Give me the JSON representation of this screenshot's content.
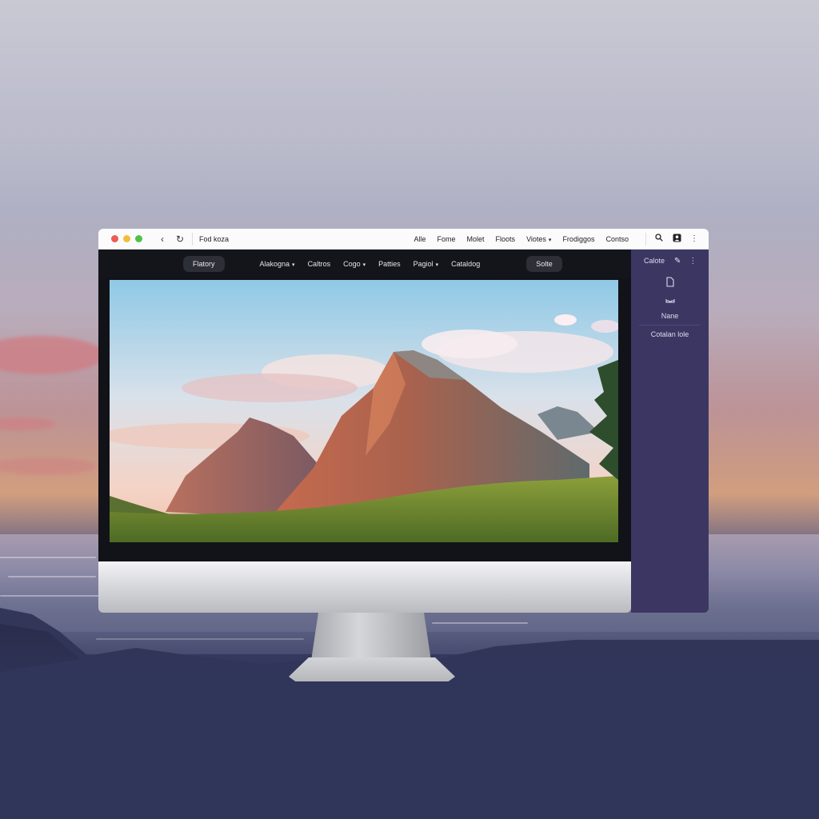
{
  "window": {
    "title": "Fod koza",
    "menu": [
      "Alle",
      "Fome",
      "Molet",
      "Floots",
      "Viotes",
      "Frodiggos",
      "Contso"
    ],
    "menu_dropdowns": [
      false,
      false,
      false,
      false,
      true,
      false,
      false
    ]
  },
  "navbar": {
    "left_pill": "Flatory",
    "links": [
      {
        "label": "Alakogna",
        "dropdown": true
      },
      {
        "label": "Caltros",
        "dropdown": false
      },
      {
        "label": "Cogo",
        "dropdown": true
      },
      {
        "label": "Patties",
        "dropdown": false
      },
      {
        "label": "Pagiol",
        "dropdown": true
      },
      {
        "label": "Cataldog",
        "dropdown": false
      }
    ],
    "right_pill": "Solte"
  },
  "sidebar": {
    "title": "Calote",
    "item_label": "Nane",
    "footer_label": "Cotalan lole"
  },
  "icons": {
    "back": "chevron-left-icon",
    "reload": "reload-icon",
    "search": "search-icon",
    "profile": "profile-icon",
    "more": "more-icon",
    "edit": "pencil-icon",
    "document": "document-icon",
    "inbox": "inbox-icon"
  },
  "colors": {
    "close": "#ed5a52",
    "minimize": "#f3bd3c",
    "maximize": "#52c14a",
    "sidebar": "#3b3762",
    "navbar": "#14151a"
  }
}
